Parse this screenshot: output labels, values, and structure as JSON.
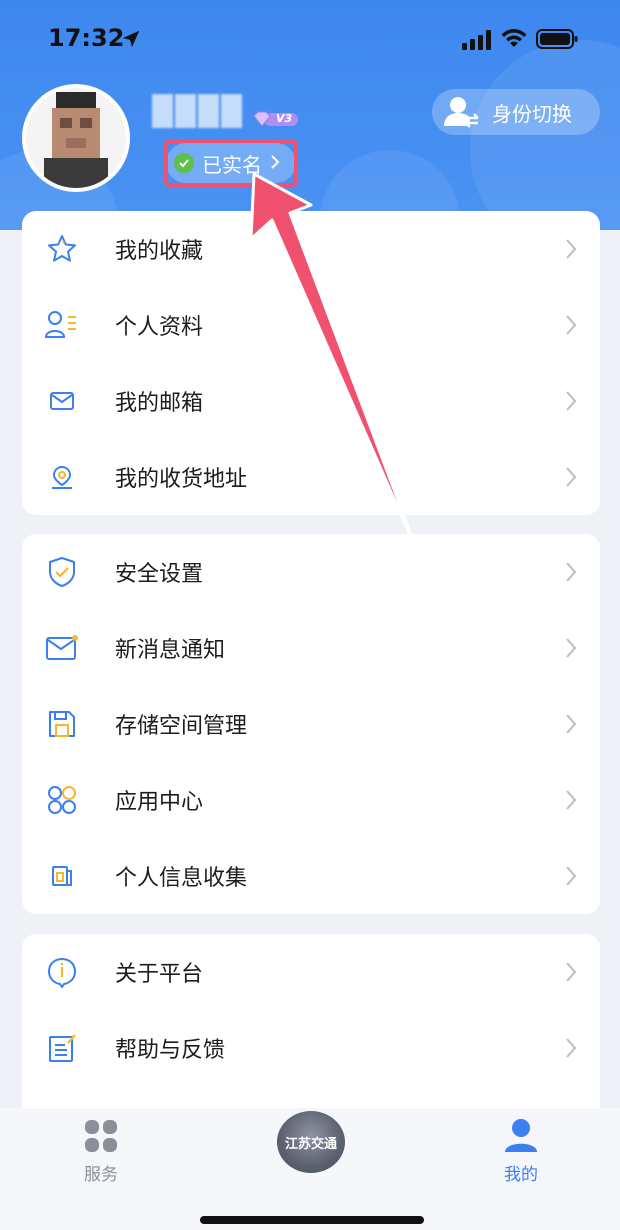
{
  "status_bar": {
    "time": "17:32"
  },
  "profile": {
    "vip_level": "V3",
    "verified_label": "已实名",
    "switch_identity_label": "身份切换"
  },
  "menu_group_1": [
    {
      "label": "我的收藏",
      "icon": "star-icon"
    },
    {
      "label": "个人资料",
      "icon": "profile-icon"
    },
    {
      "label": "我的邮箱",
      "icon": "mail-icon"
    },
    {
      "label": "我的收货地址",
      "icon": "location-icon"
    }
  ],
  "menu_group_2": [
    {
      "label": "安全设置",
      "icon": "shield-icon"
    },
    {
      "label": "新消息通知",
      "icon": "notification-mail-icon"
    },
    {
      "label": "存储空间管理",
      "icon": "save-icon"
    },
    {
      "label": "应用中心",
      "icon": "apps-icon"
    },
    {
      "label": "个人信息收集",
      "icon": "document-icon"
    }
  ],
  "menu_group_3": [
    {
      "label": "关于平台",
      "icon": "info-icon"
    },
    {
      "label": "帮助与反馈",
      "icon": "feedback-icon"
    }
  ],
  "tabbar": {
    "services_label": "服务",
    "center_logo_text": "江苏交通",
    "mine_label": "我的",
    "active_color": "#3b7ff0",
    "inactive_color": "#8a8f99"
  },
  "colors": {
    "header_blue": "#4a90f0",
    "icon_blue": "#3b7ff0",
    "accent_yellow": "#f5b731",
    "highlight_red": "#f0516f"
  }
}
